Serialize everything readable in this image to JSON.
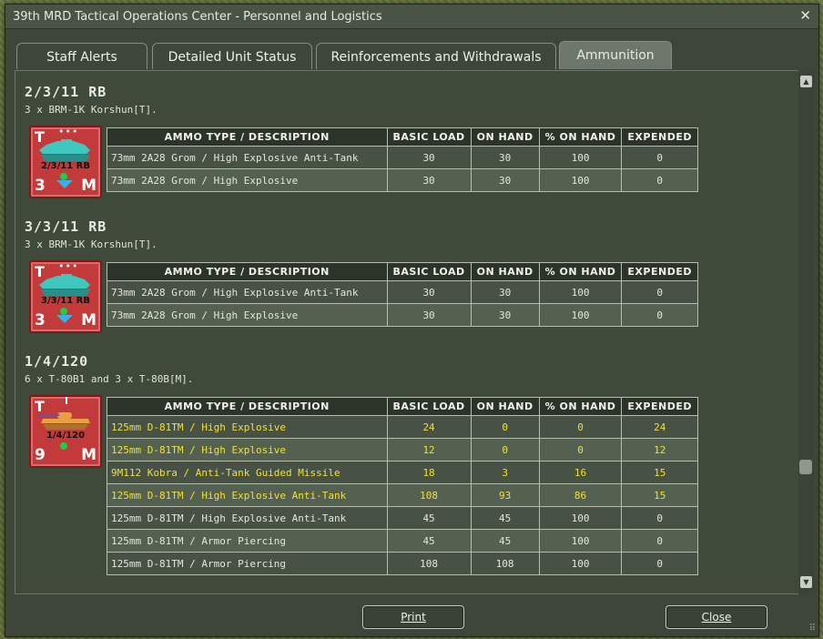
{
  "window": {
    "title": "39th MRD Tactical Operations Center - Personnel and Logistics",
    "close_glyph": "✕"
  },
  "tabs": [
    {
      "label": "Staff Alerts"
    },
    {
      "label": "Detailed Unit Status"
    },
    {
      "label": "Reinforcements and Withdrawals"
    },
    {
      "label": "Ammunition",
      "active": true
    }
  ],
  "columns": [
    "AMMO TYPE / DESCRIPTION",
    "BASIC LOAD",
    "ON HAND",
    "% ON HAND",
    "EXPENDED"
  ],
  "units": [
    {
      "name": "2/3/11 RB",
      "composition": "3 x BRM-1K Korshun[T].",
      "counter": {
        "top_left": "T",
        "bottom_left": "3",
        "bottom_right": "M",
        "label": "2/3/11 RB",
        "marks": "•••",
        "icon": "ifv-icon"
      },
      "rows": [
        {
          "desc": "73mm 2A28 Grom / High Explosive Anti-Tank",
          "basic": "30",
          "onhand": "30",
          "pct": "100",
          "exp": "0"
        },
        {
          "desc": "73mm 2A28 Grom / High Explosive",
          "basic": "30",
          "onhand": "30",
          "pct": "100",
          "exp": "0"
        }
      ]
    },
    {
      "name": "3/3/11 RB",
      "composition": "3 x BRM-1K Korshun[T].",
      "counter": {
        "top_left": "T",
        "bottom_left": "3",
        "bottom_right": "M",
        "label": "3/3/11 RB",
        "marks": "•••",
        "icon": "ifv-icon"
      },
      "rows": [
        {
          "desc": "73mm 2A28 Grom / High Explosive Anti-Tank",
          "basic": "30",
          "onhand": "30",
          "pct": "100",
          "exp": "0"
        },
        {
          "desc": "73mm 2A28 Grom / High Explosive",
          "basic": "30",
          "onhand": "30",
          "pct": "100",
          "exp": "0"
        }
      ]
    },
    {
      "name": "1/4/120",
      "composition": "6 x T-80B1 and 3 x T-80B[M].",
      "counter": {
        "top_left": "T",
        "bottom_left": "9",
        "bottom_right": "M",
        "label": "1/4/120",
        "marks": "",
        "icon": "tank-icon"
      },
      "rows": [
        {
          "desc": "125mm D-81TM / High Explosive",
          "basic": "24",
          "onhand": "0",
          "pct": "0",
          "exp": "24",
          "alert": true
        },
        {
          "desc": "125mm D-81TM / High Explosive",
          "basic": "12",
          "onhand": "0",
          "pct": "0",
          "exp": "12",
          "alert": true
        },
        {
          "desc": "9M112 Kobra / Anti-Tank Guided Missile",
          "basic": "18",
          "onhand": "3",
          "pct": "16",
          "exp": "15",
          "alert": true
        },
        {
          "desc": "125mm D-81TM / High Explosive Anti-Tank",
          "basic": "108",
          "onhand": "93",
          "pct": "86",
          "exp": "15",
          "alert": true
        },
        {
          "desc": "125mm D-81TM / High Explosive Anti-Tank",
          "basic": "45",
          "onhand": "45",
          "pct": "100",
          "exp": "0"
        },
        {
          "desc": "125mm D-81TM / Armor Piercing",
          "basic": "45",
          "onhand": "45",
          "pct": "100",
          "exp": "0"
        },
        {
          "desc": "125mm D-81TM / Armor Piercing",
          "basic": "108",
          "onhand": "108",
          "pct": "100",
          "exp": "0"
        }
      ]
    }
  ],
  "footer": {
    "print_label": "Print",
    "close_label": "Close"
  },
  "colors": {
    "alert_text": "#f2e033",
    "counter_red": "#c33a3a",
    "unit_icon": "#3fc7c0",
    "tank_icon": "#e8a040"
  }
}
